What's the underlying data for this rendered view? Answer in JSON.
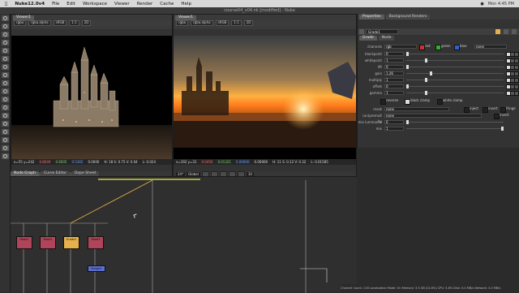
{
  "menubar": {
    "app": "Nuke12.0v4",
    "items": [
      "File",
      "Edit",
      "Workspace",
      "Viewer",
      "Render",
      "Cache",
      "Help"
    ],
    "right": [
      "Mon 4:45 PM"
    ]
  },
  "window_title": "course04_v04.nk [modified] - Nuke",
  "viewer1": {
    "tab": "Viewer1",
    "controls": [
      "rgba",
      "rgba.alpha",
      "sRGB",
      "1:1",
      "2D"
    ],
    "coords": "x=55 y=242",
    "r": "0.8049",
    "g": "0.6005",
    "b": "0.5365",
    "a": "0.0000",
    "hsv": "H: 18 S: 0.75 V: 0.04",
    "l": "L: 0.024",
    "frame": "1"
  },
  "viewer2": {
    "tab": "Viewer1",
    "controls": [
      "rgba",
      "rgba.alpha",
      "sRGB",
      "1:1",
      "2D"
    ],
    "coords": "x=192 y=31",
    "r": "0.0450",
    "g": "0.01321",
    "b": "0.00000",
    "a": "0.00000",
    "hsv": "H: 11 S: 0.12 V: 0.32",
    "l": "L: 0.01585",
    "frame": "1"
  },
  "playbar": {
    "fps": "24*",
    "scope": "Global",
    "frame": "1",
    "end": "10"
  },
  "properties": {
    "tabs": [
      "Properties",
      "Background Renders"
    ],
    "node": "Grade1",
    "subtabs": [
      "Grade",
      "Node"
    ],
    "channels_label": "channels",
    "channels_value": "rgb",
    "channel_toggles": [
      "red",
      "green",
      "blue"
    ],
    "channels_extra": "none",
    "params": [
      {
        "label": "blackpoint",
        "value": "0",
        "knob": 0.0
      },
      {
        "label": "whitepoint",
        "value": "1",
        "knob": 0.2
      },
      {
        "label": "lift",
        "value": "0",
        "knob": 0.0
      },
      {
        "label": "gain",
        "value": "1.26",
        "knob": 0.25
      },
      {
        "label": "multiply",
        "value": "1",
        "knob": 0.2
      },
      {
        "label": "offset",
        "value": "0",
        "knob": 0.0
      },
      {
        "label": "gamma",
        "value": "1",
        "knob": 0.2
      }
    ],
    "reverse": "reverse",
    "black_clamp": "black clamp",
    "white_clamp": "white clamp",
    "mask_label": "mask",
    "mask_value": "none",
    "inject": "inject",
    "invert": "invert",
    "fringe": "fringe",
    "unpremult_label": "(un)premult by",
    "unpremult_value": "none",
    "invert2": "invert",
    "mix_lum_label": "mix luminance",
    "mix_lum_value": "0",
    "mix_label": "mix",
    "mix_value": "1"
  },
  "dag": {
    "tabs": [
      "Node Graph",
      "Curve Editor",
      "Dope Sheet"
    ],
    "nodes": [
      "Read1",
      "Read2",
      "Grade1",
      "Read3",
      "Merge1"
    ]
  },
  "status": "Channel Count: 116  Localization Mode: On  Memory: 3.5 GB (24.6%)  CPU: 5.8%  Disk: 0.0 MB/s  Network: 0.0 MB/s",
  "colors": {
    "accent": "#f0a020",
    "timeline_head": "#f0a020",
    "grade_node": "#e8b04a",
    "read_node": "#b0445a",
    "merge_node": "#5a6fd0"
  }
}
